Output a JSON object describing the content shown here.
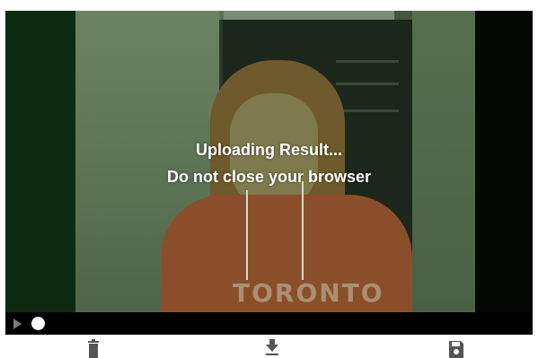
{
  "overlay": {
    "line1": "Uploading Result...",
    "line2": "Do not close your browser"
  },
  "player": {
    "play_icon": "play-icon",
    "progress_fraction": 0.0
  },
  "actions": [
    {
      "icon": "trash-icon"
    },
    {
      "icon": "download-icon"
    },
    {
      "icon": "save-icon"
    }
  ],
  "colors": {
    "icon_gray": "#555555",
    "controls_bg": "#000000",
    "overlay_text": "#ffffff"
  },
  "shirt_text": "TORONTO"
}
